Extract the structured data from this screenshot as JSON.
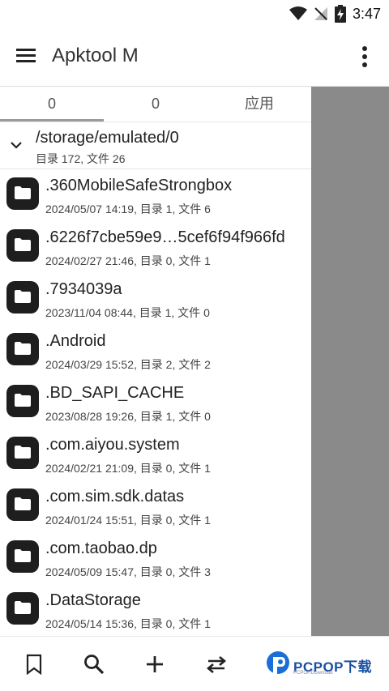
{
  "status": {
    "time": "3:47"
  },
  "app": {
    "title": "Apktool M"
  },
  "tabs": [
    {
      "label": "0"
    },
    {
      "label": "0"
    },
    {
      "label": "应用"
    }
  ],
  "path": {
    "current": "/storage/emulated/0",
    "summary": "目录 172, 文件 26"
  },
  "files": [
    {
      "name": ".360MobileSafeStrongbox",
      "meta": "2024/05/07 14:19, 目录 1, 文件 6"
    },
    {
      "name": ".6226f7cbe59e9…5cef6f94f966fd",
      "meta": "2024/02/27 21:46, 目录 0, 文件 1"
    },
    {
      "name": ".7934039a",
      "meta": "2023/11/04 08:44, 目录 1, 文件 0"
    },
    {
      "name": ".Android",
      "meta": "2024/03/29 15:52, 目录 2, 文件 2"
    },
    {
      "name": ".BD_SAPI_CACHE",
      "meta": "2023/08/28 19:26, 目录 1, 文件 0"
    },
    {
      "name": ".com.aiyou.system",
      "meta": "2024/02/21 21:09, 目录 0, 文件 1"
    },
    {
      "name": ".com.sim.sdk.datas",
      "meta": "2024/01/24 15:51, 目录 0, 文件 1"
    },
    {
      "name": ".com.taobao.dp",
      "meta": "2024/05/09 15:47, 目录 0, 文件 3"
    },
    {
      "name": ".DataStorage",
      "meta": "2024/05/14 15:36, 目录 0, 文件 1"
    }
  ],
  "bottom_bar": [
    "bookmark-icon",
    "search-icon",
    "add-icon",
    "swap-icon"
  ],
  "watermark": {
    "text": "PCPOP下载",
    "sub": "PCPOP.Download"
  }
}
